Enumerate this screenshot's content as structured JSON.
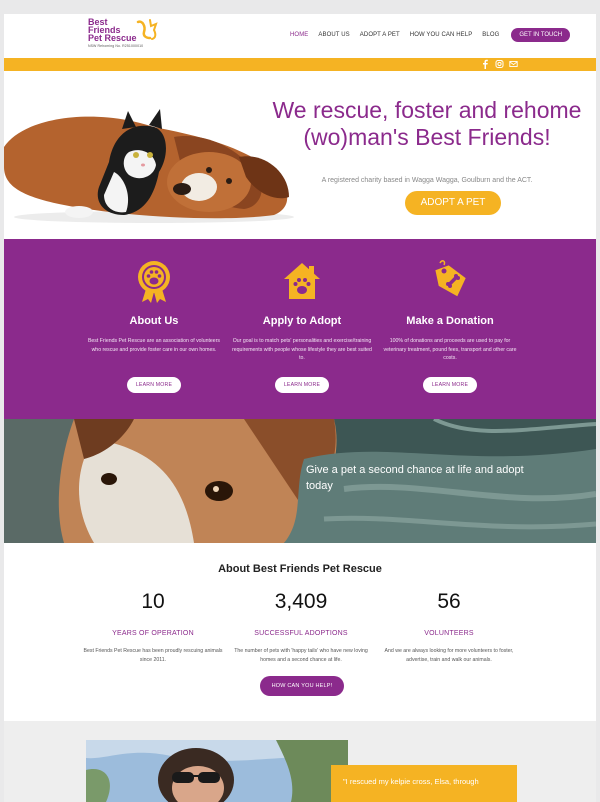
{
  "header": {
    "logo_line1": "Best",
    "logo_line2": "Friends",
    "logo_line3": "Pet Rescue",
    "logo_sub": "NSW Rehoming No. R251000010",
    "nav": [
      {
        "label": "HOME",
        "active": true
      },
      {
        "label": "ABOUT US",
        "active": false
      },
      {
        "label": "ADOPT A PET",
        "active": false
      },
      {
        "label": "HOW YOU CAN HELP",
        "active": false
      },
      {
        "label": "BLOG",
        "active": false
      }
    ],
    "cta": "GET IN TOUCH",
    "social_icons": [
      "facebook-icon",
      "instagram-icon",
      "email-icon"
    ]
  },
  "hero": {
    "title": "We rescue, foster and rehome (wo)man's Best Friends!",
    "subtitle": "A registered charity based in Wagga Wagga, Goulburn and the ACT.",
    "button": "ADOPT A PET"
  },
  "features": [
    {
      "icon": "award-paw-icon",
      "title": "About Us",
      "text": "Best Friends Pet Rescue are an association of volunteers who rescue and provide foster care in our own homes.",
      "button": "LEARN MORE"
    },
    {
      "icon": "house-paw-icon",
      "title": "Apply to Adopt",
      "text": "Our goal is to match pets' personalities and exercise/training requirements with people whose lifestyle they are best suited to.",
      "button": "LEARN MORE"
    },
    {
      "icon": "donation-tag-icon",
      "title": "Make a Donation",
      "text": "100% of donations and proceeds are used to pay for veterinary treatment, pound fees, transport and other care costs.",
      "button": "LEARN MORE"
    }
  ],
  "banner": {
    "text": "Give a pet a second chance at life and adopt today"
  },
  "about": {
    "title": "About Best Friends Pet Rescue",
    "stats": [
      {
        "number": "10",
        "label": "YEARS OF OPERATION",
        "text": "Best Friends Pet Rescue has been proudly rescuing animals since 2011."
      },
      {
        "number": "3,409",
        "label": "SUCCESSFUL ADOPTIONS",
        "text": "The number of pets with 'happy tails' who have new loving homes and a second chance at life."
      },
      {
        "number": "56",
        "label": "VOLUNTEERS",
        "text": "And we are always looking for more volunteers to foster, advertise, train and walk our animals."
      }
    ],
    "button": "HOW CAN YOU HELP!"
  },
  "testimonial": {
    "quote": "\"I rescued my kelpie cross, Elsa, through"
  },
  "colors": {
    "purple": "#8b2a8c",
    "yellow": "#f5b323"
  }
}
